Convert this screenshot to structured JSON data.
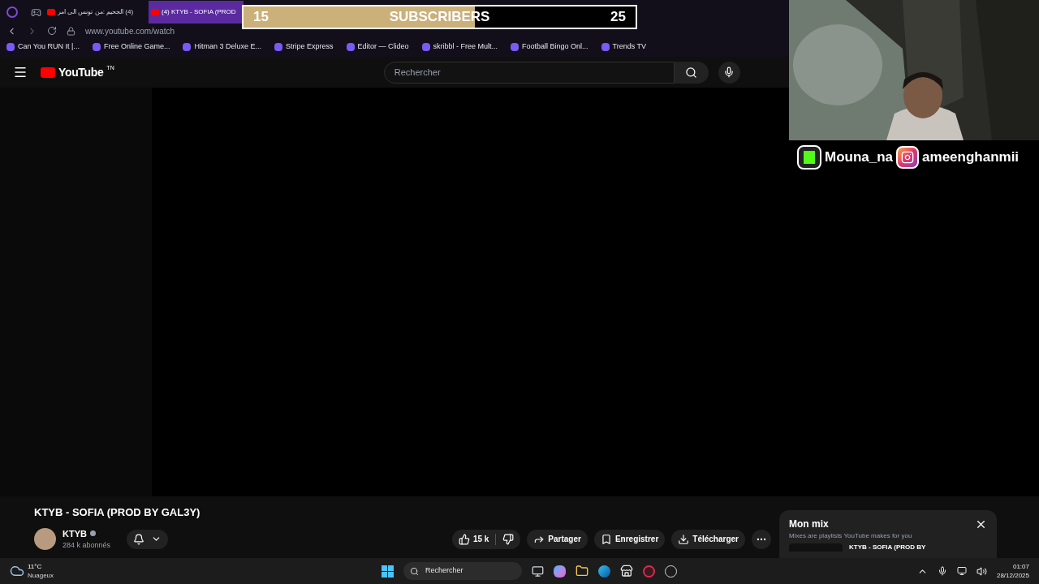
{
  "browser": {
    "tabs": [
      {
        "title": "(4) الجحيم :من تونس الى امر",
        "selected": false
      },
      {
        "title": "(4) KTYB - SOFIA (PROD",
        "selected": true
      }
    ],
    "url": "www.youtube.com/watch",
    "bookmarks": [
      "Can You RUN It |...",
      "Free Online Game...",
      "Hitman 3 Deluxe E...",
      "Stripe Express",
      "Editor — Clideo",
      "skribbl - Free Mult...",
      "Football Bingo Onl...",
      "Trends TV"
    ]
  },
  "subscriber_goal": {
    "start": "15",
    "label": "SUBSCRIBERS",
    "goal": "25",
    "level": 0.59
  },
  "webcam": {
    "kind": "picture",
    "handles": [
      "Mouna_na",
      "ameenghanmii"
    ]
  },
  "youtube": {
    "logo": "YouTube",
    "logo_mark": "TN",
    "search_placeholder": "Rechercher",
    "video": {
      "title": "KTYB - SOFIA (PROD BY GAL3Y)",
      "channel": "KTYB",
      "subscribers": "284 k abonnés",
      "likes": "15 k",
      "actions": [
        "Partager",
        "Enregistrer",
        "Télécharger"
      ]
    },
    "mix": {
      "title": "Mon mix",
      "subtitle": "Mixes are playlists YouTube makes for you",
      "item": "KTYB - SOFIA (PROD BY"
    }
  },
  "taskbar": {
    "temperature": "11°C",
    "weather": "Nuageux",
    "search_placeholder": "Rechercher",
    "time": "01:07",
    "date": "28/12/2025"
  }
}
